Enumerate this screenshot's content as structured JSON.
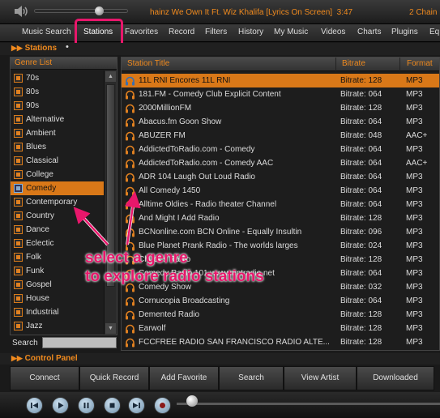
{
  "now_playing": {
    "track": "hainz We Own It Ft. Wiz Khalifa [Lyrics On Screen]",
    "time": "3:47",
    "next": "2 Chain"
  },
  "menu": [
    "Music Search",
    "Stations",
    "Favorites",
    "Record",
    "Filters",
    "History",
    "My Music",
    "Videos",
    "Charts",
    "Plugins",
    "Eq"
  ],
  "active_menu": "Stations",
  "section_title": "Stations",
  "genre_panel": {
    "header": "Genre List",
    "items": [
      "70s",
      "80s",
      "90s",
      "Alternative",
      "Ambient",
      "Blues",
      "Classical",
      "College",
      "Comedy",
      "Contemporary",
      "Country",
      "Dance",
      "Eclectic",
      "Folk",
      "Funk",
      "Gospel",
      "House",
      "Industrial",
      "Jazz"
    ],
    "selected": "Comedy"
  },
  "search": {
    "label": "Search",
    "value": ""
  },
  "stations_panel": {
    "columns": {
      "title": "Station Title",
      "bitrate": "Bitrate",
      "format": "Format"
    },
    "rows": [
      {
        "title": "11L RNI Encores 11L RNI",
        "bitrate": "Bitrate: 128",
        "format": "MP3"
      },
      {
        "title": "181.FM - Comedy Club Explicit Content",
        "bitrate": "Bitrate: 064",
        "format": "MP3"
      },
      {
        "title": "2000MillionFM",
        "bitrate": "Bitrate: 128",
        "format": "MP3"
      },
      {
        "title": "Abacus.fm Goon Show",
        "bitrate": "Bitrate: 064",
        "format": "MP3"
      },
      {
        "title": "ABUZER FM",
        "bitrate": "Bitrate: 048",
        "format": "AAC+"
      },
      {
        "title": "AddictedToRadio.com - Comedy",
        "bitrate": "Bitrate: 064",
        "format": "MP3"
      },
      {
        "title": "AddictedToRadio.com - Comedy AAC",
        "bitrate": "Bitrate: 064",
        "format": "AAC+"
      },
      {
        "title": "ADR 104 Laugh Out Loud Radio",
        "bitrate": "Bitrate: 064",
        "format": "MP3"
      },
      {
        "title": "All Comedy 1450",
        "bitrate": "Bitrate: 064",
        "format": "MP3"
      },
      {
        "title": "Alltime Oldies - Radio theater Channel",
        "bitrate": "Bitrate: 064",
        "format": "MP3"
      },
      {
        "title": "And Might I Add Radio",
        "bitrate": "Bitrate: 128",
        "format": "MP3"
      },
      {
        "title": "BCNonline.com BCN Online - Equally Insultin",
        "bitrate": "Bitrate: 096",
        "format": "MP3"
      },
      {
        "title": "Blue Planet Prank Radio - The worlds larges",
        "bitrate": "Bitrate: 024",
        "format": "MP3"
      },
      {
        "title": "Chuck's Radio",
        "bitrate": "Bitrate: 128",
        "format": "MP3"
      },
      {
        "title": "Comedy Radio 101 www.mptradio.net",
        "bitrate": "Bitrate: 064",
        "format": "MP3"
      },
      {
        "title": "Comedy Show",
        "bitrate": "Bitrate: 032",
        "format": "MP3"
      },
      {
        "title": "Cornucopia Broadcasting",
        "bitrate": "Bitrate: 064",
        "format": "MP3"
      },
      {
        "title": "Demented Radio",
        "bitrate": "Bitrate: 128",
        "format": "MP3"
      },
      {
        "title": "Earwolf",
        "bitrate": "Bitrate: 128",
        "format": "MP3"
      },
      {
        "title": "FCCFREE RADIO SAN FRANCISCO RADIO ALTE...",
        "bitrate": "Bitrate: 128",
        "format": "MP3"
      }
    ]
  },
  "control_panel": {
    "title": "Control Panel",
    "buttons": [
      "Connect",
      "Quick Record",
      "Add Favorite",
      "Search",
      "View Artist",
      "Downloaded"
    ]
  },
  "annotation": {
    "line1": "select a genre",
    "line2": "to explore radio stations"
  },
  "colors": {
    "accent": "#f08a1e",
    "selection": "#d97818",
    "annotation": "#e8176b"
  },
  "transport_icons": [
    "rewind-icon",
    "play-icon",
    "pause-icon",
    "stop-icon",
    "next-icon",
    "record-icon"
  ]
}
